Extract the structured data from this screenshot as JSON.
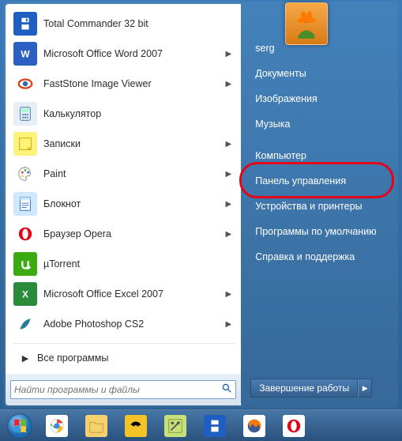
{
  "left_apps": [
    {
      "label": "Total Commander 32 bit",
      "icon": "save-disk",
      "bg": "#1f5fc2",
      "fg": "#fff",
      "has_sub": false
    },
    {
      "label": "Microsoft Office Word 2007",
      "icon": "word",
      "bg": "#2b5fc2",
      "fg": "#fff",
      "has_sub": true
    },
    {
      "label": "FastStone Image Viewer",
      "icon": "eye",
      "bg": "#ffffff",
      "fg": "#d8431c",
      "has_sub": true
    },
    {
      "label": "Калькулятор",
      "icon": "calc",
      "bg": "#e8eef6",
      "fg": "#4177b5",
      "has_sub": false
    },
    {
      "label": "Записки",
      "icon": "note",
      "bg": "#fff27a",
      "fg": "#caa10c",
      "has_sub": true
    },
    {
      "label": "Paint",
      "icon": "palette",
      "bg": "#ffffff",
      "fg": "#2a8",
      "has_sub": true
    },
    {
      "label": "Блокнот",
      "icon": "notepad",
      "bg": "#cfe8ff",
      "fg": "#2b6db2",
      "has_sub": true
    },
    {
      "label": "Браузер Opera",
      "icon": "opera",
      "bg": "#ffffff",
      "fg": "#e3061a",
      "has_sub": true
    },
    {
      "label": "µTorrent",
      "icon": "utorrent",
      "bg": "#3cab12",
      "fg": "#fff",
      "has_sub": false
    },
    {
      "label": "Microsoft Office Excel 2007",
      "icon": "excel",
      "bg": "#2a8c3a",
      "fg": "#fff",
      "has_sub": true
    },
    {
      "label": "Adobe Photoshop CS2",
      "icon": "feather",
      "bg": "#ffffff",
      "fg": "#2b6db2",
      "has_sub": true
    }
  ],
  "all_programs_label": "Все программы",
  "search": {
    "placeholder": "Найти программы и файлы"
  },
  "right_user": "serg",
  "right_items_top": [
    "Документы",
    "Изображения",
    "Музыка"
  ],
  "right_items_bottom": [
    "Компьютер",
    "Панель управления",
    "Устройства и принтеры",
    "Программы по умолчанию",
    "Справка и поддержка"
  ],
  "shutdown_label": "Завершение работы",
  "highlighted_right_index": 1,
  "taskbar": [
    {
      "name": "chrome",
      "bg": "#ffffff"
    },
    {
      "name": "explorer",
      "bg": "#f4d06f"
    },
    {
      "name": "batman",
      "bg": "#f4c326"
    },
    {
      "name": "notepadpp",
      "bg": "#c8e07a"
    },
    {
      "name": "save",
      "bg": "#1f5fc2"
    },
    {
      "name": "firefox",
      "bg": "#ffffff"
    },
    {
      "name": "opera",
      "bg": "#ffffff"
    }
  ]
}
